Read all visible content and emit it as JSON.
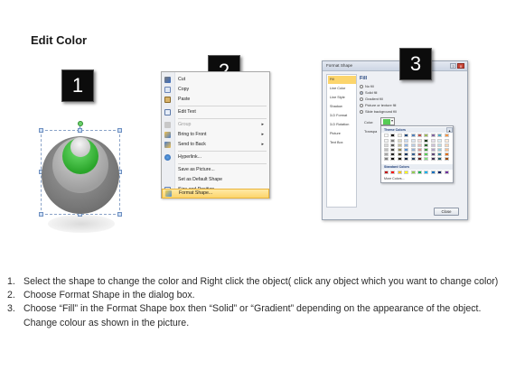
{
  "title": "Edit Color",
  "steps_badges": [
    "1",
    "2",
    "3"
  ],
  "shape": {
    "colors": {
      "outer": "#8a8a8a",
      "middle": "#b8b8b8",
      "accent": "#44cc44",
      "inner": "#e6e6e6"
    }
  },
  "context_menu": {
    "items": [
      {
        "label": "Cut",
        "icon": "scissors-icon",
        "enabled": true
      },
      {
        "label": "Copy",
        "icon": "copy-icon",
        "enabled": true
      },
      {
        "label": "Paste",
        "icon": "paste-icon",
        "enabled": true
      },
      {
        "label": "Edit Text",
        "icon": "edit-text-icon",
        "enabled": true
      },
      {
        "label": "Group",
        "icon": "group-icon",
        "enabled": false,
        "submenu": true
      },
      {
        "label": "Bring to Front",
        "icon": "bring-front-icon",
        "enabled": true,
        "submenu": true
      },
      {
        "label": "Send to Back",
        "icon": "send-back-icon",
        "enabled": true,
        "submenu": true
      },
      {
        "label": "Hyperlink...",
        "icon": "hyperlink-icon",
        "enabled": true
      },
      {
        "label": "Save as Picture...",
        "icon": "",
        "enabled": true
      },
      {
        "label": "Set as Default Shape",
        "icon": "",
        "enabled": true
      },
      {
        "label": "Size and Position...",
        "icon": "size-icon",
        "enabled": true
      },
      {
        "label": "Format Shape...",
        "icon": "format-shape-icon",
        "enabled": true,
        "highlighted": true
      }
    ]
  },
  "dialog": {
    "title": "Format Shape",
    "help": "?",
    "close_x": "x",
    "nav": [
      "Fill",
      "Line Color",
      "Line Style",
      "Shadow",
      "3-D Format",
      "3-D Rotation",
      "Picture",
      "Text Box"
    ],
    "fill_heading": "Fill",
    "fill_options": [
      {
        "label": "No fill",
        "selected": false
      },
      {
        "label": "Solid fill",
        "selected": true
      },
      {
        "label": "Gradient fill",
        "selected": false
      },
      {
        "label": "Picture or texture fill",
        "selected": false
      },
      {
        "label": "Slide background fill",
        "selected": false
      }
    ],
    "color_label": "Color:",
    "transparency_label": "Transpa",
    "theme_colors_label": "Theme Colors",
    "standard_colors_label": "Standard Colors",
    "more_colors_label": "More Colors...",
    "theme_top": [
      "#ffffff",
      "#000000",
      "#eeece1",
      "#1f497d",
      "#4f81bd",
      "#c0504d",
      "#9bbb59",
      "#8064a2",
      "#4bacc6",
      "#f79646"
    ],
    "theme_tints": [
      [
        "#f2f2f2",
        "#7f7f7f",
        "#ddd9c3",
        "#c6d9f0",
        "#dbe5f1",
        "#f2dcdb",
        "#ebf1dd",
        "#e5e0ec",
        "#dbeef3",
        "#fdeada"
      ],
      [
        "#d8d8d8",
        "#595959",
        "#c4bd97",
        "#8db3e2",
        "#b8cce4",
        "#e5b9b7",
        "#d7e3bc",
        "#ccc1d9",
        "#b7dde8",
        "#fbd5b5"
      ],
      [
        "#bfbfbf",
        "#3f3f3f",
        "#938953",
        "#548dd4",
        "#95b3d7",
        "#d99694",
        "#c3d69b",
        "#b2a2c7",
        "#92cddc",
        "#fac08f"
      ],
      [
        "#a5a5a5",
        "#262626",
        "#494429",
        "#17365d",
        "#366092",
        "#953734",
        "#76923c",
        "#5f497a",
        "#31859b",
        "#e36c09"
      ],
      [
        "#7f7f7f",
        "#0c0c0c",
        "#1d1b10",
        "#0f243e",
        "#244061",
        "#632423",
        "#4f6128",
        "#3f3151",
        "#205867",
        "#974806"
      ]
    ],
    "theme_override": [
      "#1e3a1e",
      "#2f6b2f",
      "#3f9a3f",
      "#55cc55",
      "#7fe07f",
      "#a8eca8",
      "#c8f5c8",
      "#e2fbe2"
    ],
    "standard": [
      "#c00000",
      "#ff0000",
      "#ffc000",
      "#ffff00",
      "#92d050",
      "#00b050",
      "#00b0f0",
      "#0070c0",
      "#002060",
      "#7030a0"
    ],
    "close_label": "Close"
  },
  "instructions": [
    {
      "num": "1.",
      "text": "Select the shape to change the color and Right click the object( click any object which you want to change color)"
    },
    {
      "num": "2.",
      "text": "Choose Format Shape in the dialog box."
    },
    {
      "num": "3.",
      "text": "Choose “Fill” in the Format Shape box then “Solid” or “Gradient” depending on the appearance of the object. Change colour as shown in the picture."
    }
  ]
}
